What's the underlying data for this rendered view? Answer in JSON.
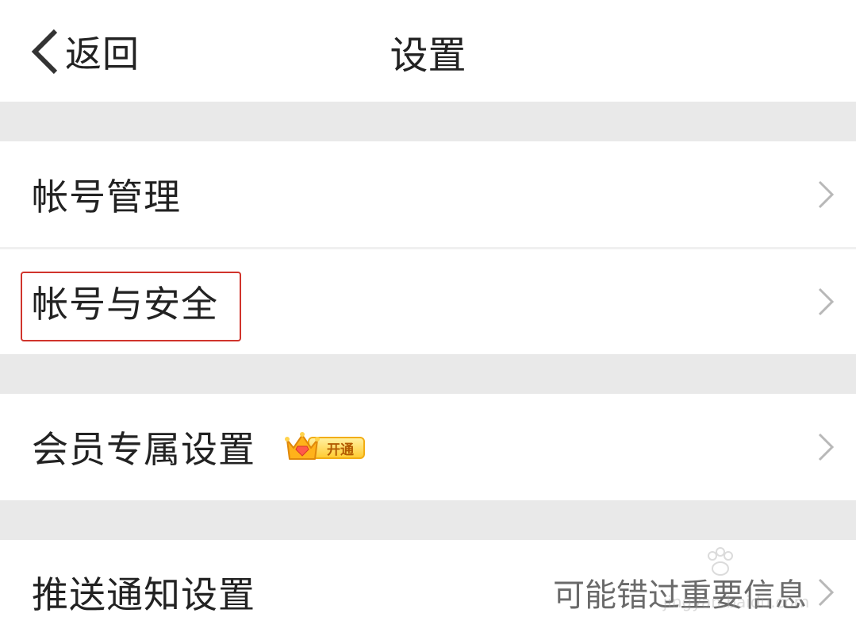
{
  "header": {
    "back_label": "返回",
    "title": "设置"
  },
  "rows": [
    {
      "label": "帐号管理"
    },
    {
      "label": "帐号与安全"
    },
    {
      "label": "会员专属设置",
      "badge": "开通"
    },
    {
      "label": "推送通知设置",
      "hint": "可能错过重要信息"
    }
  ],
  "watermark": {
    "text": "jingyan.baidu.com"
  },
  "colors": {
    "background": "#ffffff",
    "section_gap": "#e9e9e9",
    "text": "#222222",
    "hint_text": "#6a6a6a",
    "highlight_border": "#d0342c",
    "badge_fill": "#ffcc33"
  },
  "icons": {
    "back": "chevron-left-icon",
    "row_arrow": "chevron-right-icon",
    "vip": "crown-icon",
    "watermark": "paw-icon"
  }
}
